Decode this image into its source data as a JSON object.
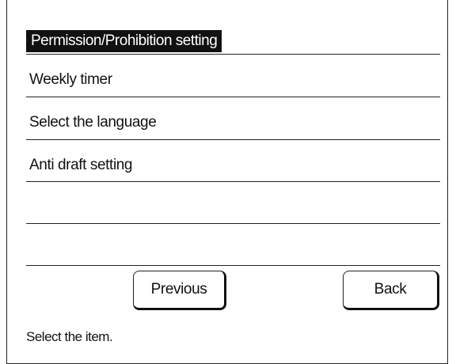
{
  "header": {
    "title": "Permission/Prohibition setting"
  },
  "menu": {
    "items": [
      {
        "label": "Weekly timer"
      },
      {
        "label": "Select the language"
      },
      {
        "label": "Anti draft setting"
      },
      {
        "label": ""
      },
      {
        "label": ""
      }
    ]
  },
  "buttons": {
    "previous_label": "Previous",
    "back_label": "Back"
  },
  "status": {
    "message": "Select the item."
  }
}
